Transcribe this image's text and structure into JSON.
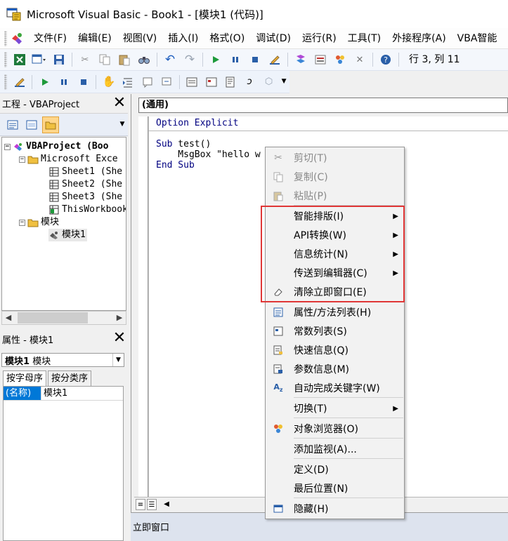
{
  "window": {
    "title": "Microsoft Visual Basic - Book1 - [模块1 (代码)]"
  },
  "menubar": {
    "items": [
      "文件(F)",
      "编辑(E)",
      "视图(V)",
      "插入(I)",
      "格式(O)",
      "调试(D)",
      "运行(R)",
      "工具(T)",
      "外接程序(A)",
      "VBA智能"
    ]
  },
  "toolbar": {
    "cursor_position": "行 3, 列 11"
  },
  "project_panel": {
    "title": "工程 - VBAProject",
    "tree": [
      {
        "label": "VBAProject (Boo",
        "indent": 0,
        "toggle": "-",
        "icon": "vba-project-icon",
        "bold": true
      },
      {
        "label": "Microsoft Exce",
        "indent": 1,
        "toggle": "-",
        "icon": "folder-icon"
      },
      {
        "label": "Sheet1 (She",
        "indent": 2,
        "toggle": "",
        "icon": "sheet-icon"
      },
      {
        "label": "Sheet2 (She",
        "indent": 2,
        "toggle": "",
        "icon": "sheet-icon"
      },
      {
        "label": "Sheet3 (She",
        "indent": 2,
        "toggle": "",
        "icon": "sheet-icon"
      },
      {
        "label": "ThisWorkbook",
        "indent": 2,
        "toggle": "",
        "icon": "workbook-icon"
      },
      {
        "label": "模块",
        "indent": 1,
        "toggle": "-",
        "icon": "folder-icon"
      },
      {
        "label": "模块1",
        "indent": 2,
        "toggle": "",
        "icon": "module-icon",
        "selected": true
      }
    ]
  },
  "properties_panel": {
    "title": "属性 - 模块1",
    "object_name": "模块1",
    "object_type": "模块",
    "tabs": [
      "按字母序",
      "按分类序"
    ],
    "rows": [
      {
        "name": "(名称)",
        "value": "模块1"
      }
    ]
  },
  "code_window": {
    "object_combo": "(通用)",
    "lines": [
      "Option Explicit",
      "",
      "Sub test()",
      "    MsgBox \"hello w",
      "End Sub"
    ]
  },
  "immediate_window": {
    "title": "立即窗口"
  },
  "context_menu": {
    "items": [
      {
        "label": "剪切(T)",
        "icon": "scissors-icon",
        "disabled": true,
        "submenu": false
      },
      {
        "label": "复制(C)",
        "icon": "copy-icon",
        "disabled": true,
        "submenu": false
      },
      {
        "label": "粘贴(P)",
        "icon": "paste-icon",
        "disabled": true,
        "submenu": false
      },
      {
        "label": "智能排版(I)",
        "icon": "",
        "disabled": false,
        "submenu": true
      },
      {
        "label": "API转换(W)",
        "icon": "",
        "disabled": false,
        "submenu": true
      },
      {
        "label": "信息统计(N)",
        "icon": "",
        "disabled": false,
        "submenu": true
      },
      {
        "label": "传送到编辑器(C)",
        "icon": "",
        "disabled": false,
        "submenu": true
      },
      {
        "label": "清除立即窗口(E)",
        "icon": "eraser-icon",
        "disabled": false,
        "submenu": false
      },
      {
        "label": "属性/方法列表(H)",
        "icon": "list-members-icon",
        "disabled": false,
        "submenu": false
      },
      {
        "label": "常数列表(S)",
        "icon": "list-constants-icon",
        "disabled": false,
        "submenu": false
      },
      {
        "label": "快速信息(Q)",
        "icon": "quick-info-icon",
        "disabled": false,
        "submenu": false
      },
      {
        "label": "参数信息(M)",
        "icon": "parameter-info-icon",
        "disabled": false,
        "submenu": false
      },
      {
        "label": "自动完成关键字(W)",
        "icon": "complete-word-icon",
        "disabled": false,
        "submenu": false
      },
      {
        "label": "切换(T)",
        "icon": "",
        "disabled": false,
        "submenu": true
      },
      {
        "label": "对象浏览器(O)",
        "icon": "object-browser-icon",
        "disabled": false,
        "submenu": false
      },
      {
        "label": "添加监视(A)...",
        "icon": "",
        "disabled": false,
        "submenu": false
      },
      {
        "label": "定义(D)",
        "icon": "",
        "disabled": false,
        "submenu": false
      },
      {
        "label": "最后位置(N)",
        "icon": "",
        "disabled": false,
        "submenu": false
      },
      {
        "label": "隐藏(H)",
        "icon": "hide-window-icon",
        "disabled": false,
        "submenu": false
      }
    ],
    "highlight_color": "#e03636"
  }
}
